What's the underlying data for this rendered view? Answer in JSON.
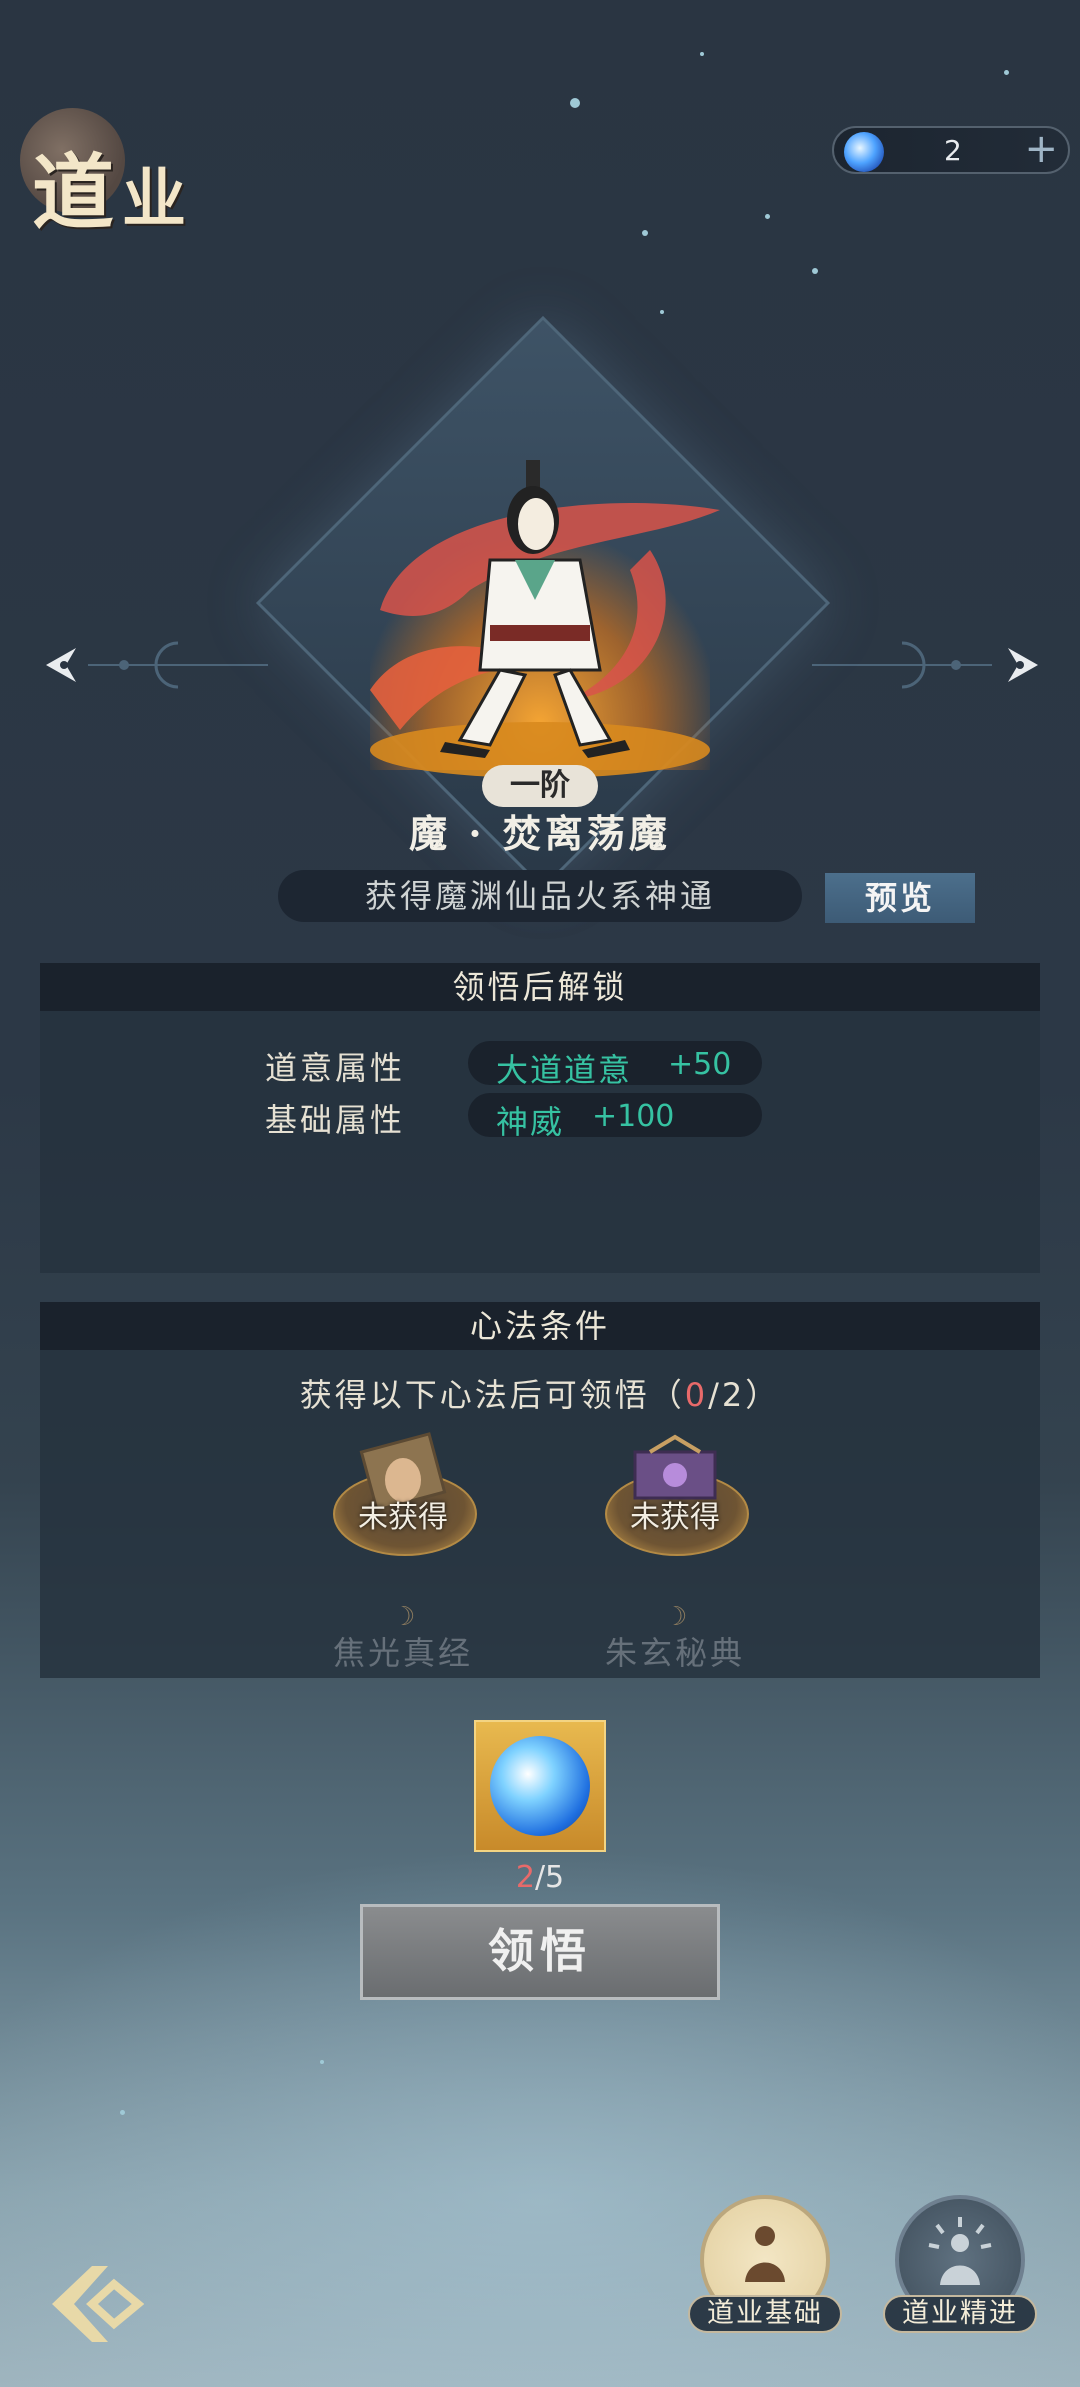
{
  "header": {
    "title_char1": "道",
    "title_char2": "业"
  },
  "currency": {
    "amount": "2",
    "icon": "spirit-orb-icon",
    "add_label": "+"
  },
  "skill": {
    "rank": "一阶",
    "name": "魔 · 焚离荡魔",
    "description": "获得魔渊仙品火系神通",
    "preview_label": "预览"
  },
  "unlock_panel": {
    "title": "领悟后解锁",
    "rows": [
      {
        "label": "道意属性",
        "attr": "大道道意",
        "value": "+50"
      },
      {
        "label": "基础属性",
        "attr": "神威",
        "value": "+100"
      }
    ]
  },
  "condition_panel": {
    "title": "心法条件",
    "text_prefix": "获得以下心法后可领悟（",
    "progress_current": "0",
    "progress_sep_total": "/2",
    "text_suffix": "）",
    "books": [
      {
        "status": "未获得",
        "name": "焦光真经"
      },
      {
        "status": "未获得",
        "name": "朱玄秘典"
      }
    ]
  },
  "cost": {
    "owned": "2",
    "required_suffix": "/5",
    "icon": "spirit-orb-icon"
  },
  "actions": {
    "comprehend_label": "领悟"
  },
  "bottom_nav": {
    "basic_label": "道业基础",
    "advance_label": "道业精进"
  },
  "colors": {
    "attr_green": "#36c2a2",
    "warning_red": "#e86a6a",
    "bg_dark": "#2a3542",
    "gold": "#e8b94f"
  }
}
